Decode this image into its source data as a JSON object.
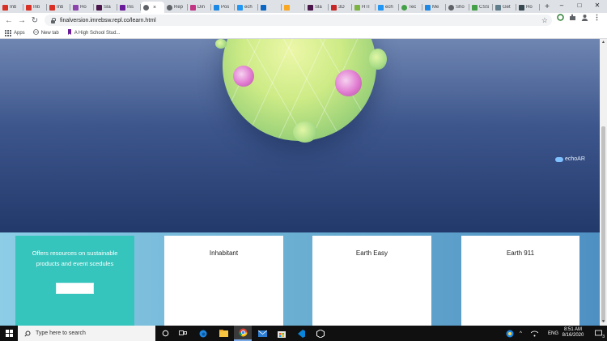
{
  "browser": {
    "tabs": [
      {
        "label": "Inb",
        "icon": "gmail-icon",
        "color": "#d93025"
      },
      {
        "label": "Inb",
        "icon": "gmail-icon",
        "color": "#d93025"
      },
      {
        "label": "Inb",
        "icon": "gmail-icon",
        "color": "#d93025"
      },
      {
        "label": "Ho",
        "icon": "purple-app-icon",
        "color": "#8e44ad"
      },
      {
        "label": "Sla",
        "icon": "slack-icon",
        "color": "#4a154b"
      },
      {
        "label": "Ins",
        "icon": "purple-square-icon",
        "color": "#6a1b9a"
      },
      {
        "label": "",
        "icon": "page-icon",
        "color": "#5f6368",
        "active": true
      },
      {
        "label": "Rep",
        "icon": "globe-icon",
        "color": "#5f6368"
      },
      {
        "label": "Din",
        "icon": "instagram-icon",
        "color": "#c13584"
      },
      {
        "label": "Pos",
        "icon": "messenger-icon",
        "color": "#1e88e5"
      },
      {
        "label": "ech",
        "icon": "cloud-icon",
        "color": "#2196f3"
      },
      {
        "label": "",
        "icon": "linkedin-icon",
        "color": "#0a66c2"
      },
      {
        "label": "",
        "icon": "pencil-icon",
        "color": "#f9a825"
      },
      {
        "label": "Sla",
        "icon": "slack-icon",
        "color": "#4a154b"
      },
      {
        "label": "3D",
        "icon": "red-app-icon",
        "color": "#c62828"
      },
      {
        "label": "HTI",
        "icon": "green-app-icon",
        "color": "#7cb342"
      },
      {
        "label": "ech",
        "icon": "cloud-icon",
        "color": "#2196f3"
      },
      {
        "label": "Tec",
        "icon": "circle-icon",
        "color": "#43a047"
      },
      {
        "label": "Me",
        "icon": "messenger-icon",
        "color": "#1e88e5"
      },
      {
        "label": "Sho",
        "icon": "globe-icon",
        "color": "#5f6368"
      },
      {
        "label": "CSS",
        "icon": "green-app-icon",
        "color": "#43a047"
      },
      {
        "label": "Get",
        "icon": "grid-icon",
        "color": "#607d8b"
      },
      {
        "label": "Ho",
        "icon": "dark-app-icon",
        "color": "#37474f"
      }
    ],
    "new_tab": "+",
    "window_controls": {
      "minimize": "–",
      "maximize": "□",
      "close": "✕"
    },
    "nav": {
      "back": "←",
      "forward": "→",
      "reload": "↻"
    },
    "url": "finalversion.imrebsw.repl.co/learn.html",
    "bookmarks": [
      {
        "label": "Apps",
        "icon": "apps-grid-icon"
      },
      {
        "label": "New tab",
        "icon": "globe-icon"
      },
      {
        "label": "A High School Stud...",
        "icon": "bookmark-icon"
      }
    ]
  },
  "page": {
    "brand": "echoAR",
    "offer_text": "Offers resources on sustainable products and event scedules",
    "cards": [
      "Inhabitant",
      "Earth Easy",
      "Earth 911"
    ]
  },
  "taskbar": {
    "search_placeholder": "Type here to search",
    "language": "ENG",
    "time": "8:51 AM",
    "date": "8/16/2020",
    "notification_count": "3"
  }
}
